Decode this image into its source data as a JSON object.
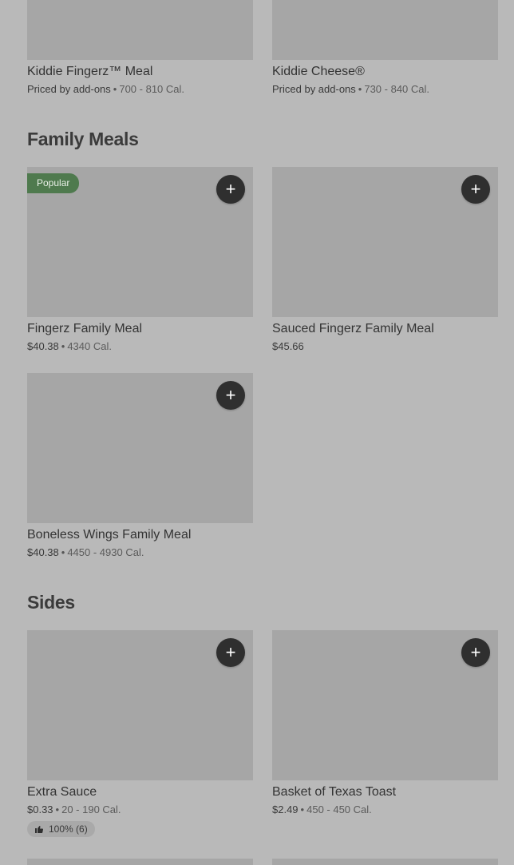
{
  "kids": [
    {
      "name": "Kiddie Fingerz™ Meal",
      "price": "Priced by add-ons",
      "cal": "700 - 810 Cal."
    },
    {
      "name": "Kiddie Cheese®",
      "price": "Priced by add-ons",
      "cal": "730 - 840 Cal."
    }
  ],
  "family": {
    "title": "Family Meals",
    "badge": "Popular",
    "items": [
      {
        "name": "Fingerz Family Meal",
        "price": "$40.38",
        "cal": "4340 Cal."
      },
      {
        "name": "Sauced Fingerz Family Meal",
        "price": "$45.66"
      },
      {
        "name": "Boneless Wings Family Meal",
        "price": "$40.38",
        "cal": "4450 - 4930 Cal."
      }
    ]
  },
  "sides": {
    "title": "Sides",
    "items": [
      {
        "name": "Extra Sauce",
        "price": "$0.33",
        "cal": "20 - 190 Cal.",
        "rating": "100% (6)"
      },
      {
        "name": "Basket of Texas Toast",
        "price": "$2.49",
        "cal": "450 - 450 Cal."
      }
    ]
  },
  "icons": {
    "add": "plus-icon",
    "rating": "thumbs-up-icon"
  },
  "add_symbol": "+",
  "dot": "•"
}
